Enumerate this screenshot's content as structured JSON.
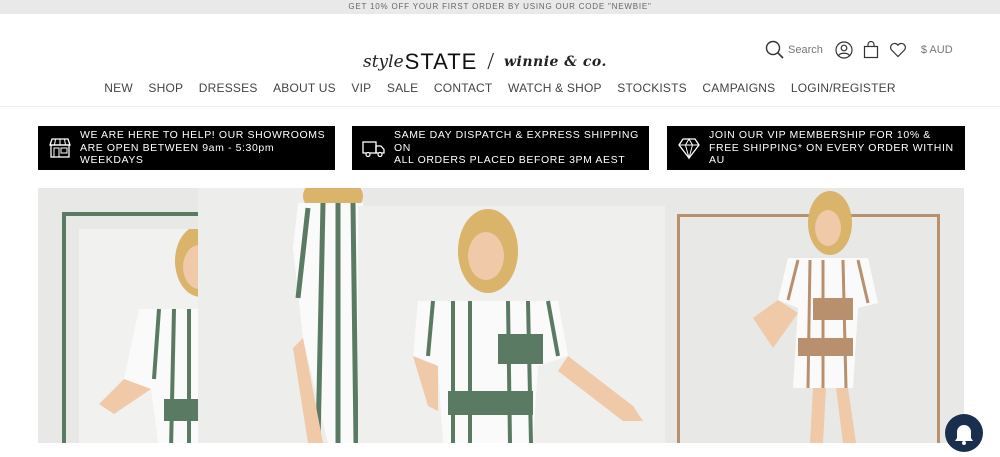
{
  "announcement": "GET 10% OFF YOUR FIRST ORDER BY USING OUR CODE \"NEWBIE\"",
  "logo": {
    "style": "style",
    "state": "STATE",
    "slash": "/",
    "winnie": "winnie & co."
  },
  "utility": {
    "search": "Search",
    "currency": "$ AUD",
    "icons": [
      "search-icon",
      "account-icon",
      "bag-icon",
      "heart-icon"
    ]
  },
  "nav": [
    "NEW",
    "SHOP",
    "DRESSES",
    "ABOUT US",
    "VIP",
    "SALE",
    "CONTACT",
    "WATCH & SHOP",
    "STOCKISTS",
    "CAMPAIGNS",
    "LOGIN/REGISTER"
  ],
  "promos": [
    {
      "icon": "store-icon",
      "line1": "WE ARE HERE TO HELP! OUR SHOWROOMS",
      "line2": "ARE OPEN BETWEEN 9am - 5:30pm WEEKDAYS"
    },
    {
      "icon": "truck-icon",
      "line1": "SAME DAY DISPATCH & EXPRESS SHIPPING ON",
      "line2": "ALL ORDERS PLACED BEFORE 3PM AEST"
    },
    {
      "icon": "diamond-icon",
      "line1": "JOIN OUR VIP MEMBERSHIP FOR 10% &",
      "line2": "FREE SHIPPING* ON EVERY ORDER WITHIN AU"
    }
  ],
  "colors": {
    "green": "#5b7a63",
    "tan": "#b8906e",
    "chat": "#1a2f4e"
  }
}
